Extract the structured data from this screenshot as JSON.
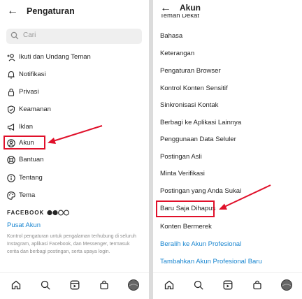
{
  "left": {
    "title": "Pengaturan",
    "search_placeholder": "Cari",
    "items": [
      {
        "label": "Ikuti dan Undang Teman",
        "icon": "add-person-icon"
      },
      {
        "label": "Notifikasi",
        "icon": "bell-icon"
      },
      {
        "label": "Privasi",
        "icon": "lock-icon"
      },
      {
        "label": "Keamanan",
        "icon": "shield-check-icon"
      },
      {
        "label": "Iklan",
        "icon": "megaphone-icon"
      },
      {
        "label": "Akun",
        "icon": "account-circle-icon"
      },
      {
        "label": "Bantuan",
        "icon": "lifebuoy-icon"
      },
      {
        "label": "Tentang",
        "icon": "info-icon"
      },
      {
        "label": "Tema",
        "icon": "palette-icon"
      }
    ],
    "facebook_heading": "FACEBOOK",
    "accounts_center": "Pusat Akun",
    "accounts_center_desc": "Kontrol pengaturan untuk pengalaman terhubung di seluruh Instagram, aplikasi Facebook, dan Messenger, termasuk cerita dan berbagi postingan, serta upaya login."
  },
  "right": {
    "title": "Akun",
    "items": [
      "Teman Dekat",
      "Bahasa",
      "Keterangan",
      "Pengaturan Browser",
      "Kontrol Konten Sensitif",
      "Sinkronisasi Kontak",
      "Berbagi ke Aplikasi Lainnya",
      "Penggunaan Data Seluler",
      "Postingan Asli",
      "Minta Verifikasi",
      "Postingan yang Anda Sukai",
      "Baru Saja Dihapus",
      "Konten Bermerek"
    ],
    "links": [
      "Beralih ke Akun Profesional",
      "Tambahkan Akun Profesional Baru"
    ]
  },
  "colors": {
    "highlight": "#e0102a",
    "link": "#1a86d0",
    "text": "#262626"
  },
  "nav_icons": [
    "home-icon",
    "search-icon",
    "reels-icon",
    "shop-icon",
    "profile-avatar-icon"
  ]
}
